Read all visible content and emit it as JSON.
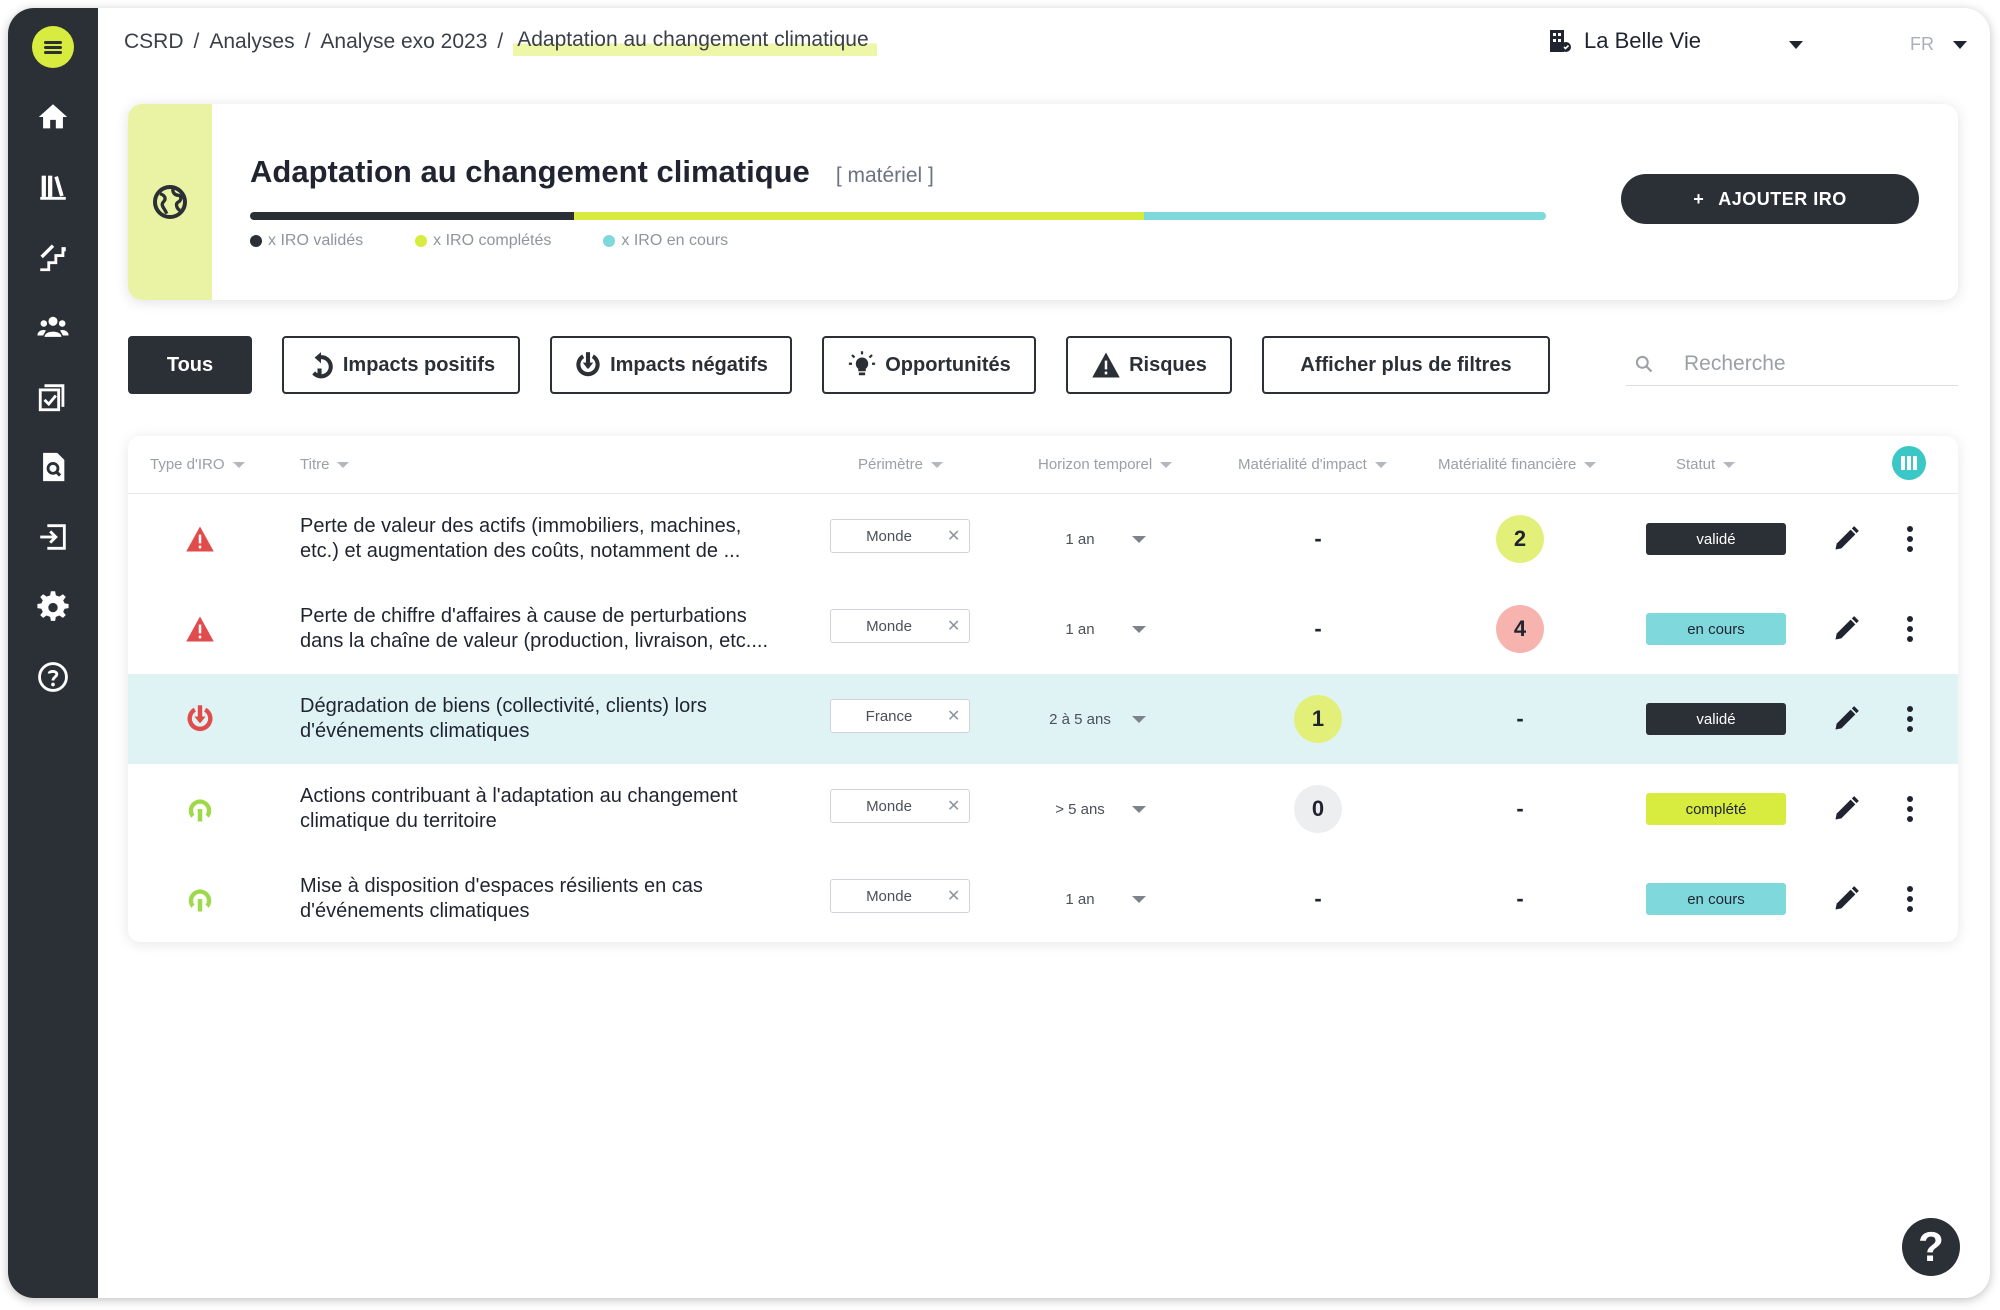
{
  "colors": {
    "sidebar": "#2b3036",
    "accent_lime": "#d7ec3e",
    "accent_teal": "#3cc7c7",
    "risk_red": "#e04b4b",
    "positive_green": "#9ed94a",
    "highlight_row": "#dff3f5"
  },
  "sidebar": {
    "items": [
      {
        "icon": "home-icon"
      },
      {
        "icon": "library-icon"
      },
      {
        "icon": "stairs-icon"
      },
      {
        "icon": "users-icon"
      },
      {
        "icon": "checklist-icon"
      },
      {
        "icon": "search-document-icon"
      },
      {
        "icon": "import-icon"
      },
      {
        "icon": "gear-icon"
      },
      {
        "icon": "help-circle-icon"
      }
    ]
  },
  "breadcrumb": [
    "CSRD",
    "Analyses",
    "Analyse exo 2023",
    "Adaptation au changement climatique"
  ],
  "breadcrumb_sep": "/",
  "org_name": "La Belle Vie",
  "language": "FR",
  "header": {
    "title": "Adaptation au changement climatique",
    "tag": "[ matériel ]",
    "progress": [
      {
        "label": "x IRO validés",
        "fraction": 0.25,
        "color": "#2b3036"
      },
      {
        "label": "x IRO complétés",
        "fraction": 0.44,
        "color": "#d7ec3e"
      },
      {
        "label": "x IRO en cours",
        "fraction": 0.31,
        "color": "#7fd8dc"
      }
    ],
    "add_button": "AJOUTER IRO",
    "add_button_plus": "+"
  },
  "filters": {
    "all": "Tous",
    "positive": "Impacts positifs",
    "negative": "Impacts négatifs",
    "opportunities": "Opportunités",
    "risks": "Risques",
    "more": "Afficher plus de filtres"
  },
  "search": {
    "placeholder": "Recherche"
  },
  "table": {
    "columns": {
      "type": "Type d'IRO",
      "title": "Titre",
      "perimeter": "Périmètre",
      "horizon": "Horizon temporel",
      "impact": "Matérialité d'impact",
      "financial": "Matérialité financière",
      "status": "Statut"
    },
    "rows": [
      {
        "type": "risk",
        "title_l1": "Perte de valeur des actifs (immobiliers, machines,",
        "title_l2": "etc.) et augmentation des coûts, notamment de ...",
        "perimeter": "Monde",
        "horizon": "1 an",
        "impact": "-",
        "financial": "2",
        "status": "validé",
        "highlight": false
      },
      {
        "type": "risk",
        "title_l1": "Perte de chiffre d'affaires à cause de perturbations",
        "title_l2": "dans la chaîne de valeur (production, livraison, etc....",
        "perimeter": "Monde",
        "horizon": "1 an",
        "impact": "-",
        "financial": "4",
        "status": "en cours",
        "highlight": false
      },
      {
        "type": "negative",
        "title_l1": "Dégradation de biens (collectivité, clients) lors",
        "title_l2": "d'événements climatiques",
        "perimeter": "France",
        "horizon": "2 à 5 ans",
        "impact": "1",
        "financial": "-",
        "status": "validé",
        "highlight": true
      },
      {
        "type": "positive",
        "title_l1": "Actions contribuant à l'adaptation au changement",
        "title_l2": "climatique du territoire",
        "perimeter": "Monde",
        "horizon": "> 5 ans",
        "impact": "0",
        "financial": "-",
        "status": "complété",
        "highlight": false
      },
      {
        "type": "positive",
        "title_l1": "Mise à disposition d'espaces résilients en cas",
        "title_l2": "d'événements climatiques",
        "perimeter": "Monde",
        "horizon": "1 an",
        "impact": "-",
        "financial": "-",
        "status": "en cours",
        "highlight": false
      }
    ],
    "status_styles": {
      "validé": {
        "bg": "#2b3036",
        "fg": "#ffffff"
      },
      "en cours": {
        "bg": "#7fd8dc",
        "fg": "#1f2430"
      },
      "complété": {
        "bg": "#d7ec3e",
        "fg": "#1f2430"
      }
    },
    "badge_colors": {
      "0": "#eceeef",
      "1": "#e2f07a",
      "2": "#e2f07a",
      "4": "#f7b3ad"
    }
  },
  "help": "?"
}
